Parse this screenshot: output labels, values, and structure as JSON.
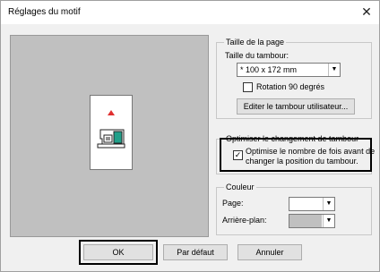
{
  "window": {
    "title": "Réglages du motif",
    "close_glyph": "✕"
  },
  "page_size": {
    "legend": "Taille de la page",
    "hoop_label": "Taille du tambour:",
    "hoop_value": "* 100 x 172 mm",
    "rotation_label": "Rotation 90 degrés",
    "rotation_checked": false,
    "edit_hoop_button": "Editer le tambour utilisateur..."
  },
  "hoop_change": {
    "legend": "Optimiser le changement de tambour",
    "optimize_label_line1": "Optimise le nombre de fois avant de",
    "optimize_label_line2": "changer la position du tambour.",
    "optimize_checked": true,
    "check_glyph": "✓"
  },
  "color": {
    "legend": "Couleur",
    "page_label": "Page:",
    "page_color": "#ffffff",
    "background_label": "Arrière-plan:",
    "background_color": "#c0c0c0"
  },
  "buttons": {
    "ok": "OK",
    "default": "Par défaut",
    "cancel": "Annuler"
  },
  "dropdown_glyph": "▼",
  "colors": {
    "hoop_marker": "#e03030",
    "machine_accent": "#21a08a"
  }
}
